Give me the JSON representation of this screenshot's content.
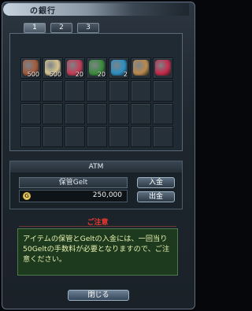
{
  "window": {
    "title": "の銀行"
  },
  "tabs": [
    {
      "label": "1"
    },
    {
      "label": "2"
    },
    {
      "label": "3"
    }
  ],
  "items": [
    {
      "icon": "meat-bundle-icon",
      "qty": "500",
      "color": "#a35a3b"
    },
    {
      "icon": "bottle-icon",
      "qty": "500",
      "color": "#d7c48f"
    },
    {
      "icon": "red-gem-icon",
      "qty": "20",
      "color": "#c23d56"
    },
    {
      "icon": "green-herb-icon",
      "qty": "20",
      "color": "#3b8b3c"
    },
    {
      "icon": "blue-crystal-icon",
      "qty": "2",
      "color": "#2d8fc2"
    },
    {
      "icon": "bread-icon",
      "qty": "",
      "color": "#b98a4d"
    },
    {
      "icon": "red-blue-orb-icon",
      "qty": "",
      "color": "#c32b4c"
    }
  ],
  "atm": {
    "heading": "ATM",
    "deposit_label": "保管Gelt",
    "coin_symbol": "G",
    "amount": "250,000",
    "deposit_button": "入金",
    "withdraw_button": "出金"
  },
  "notice": {
    "heading": "ご注意",
    "text": "アイテムの保管とGeltの入金には、一回当り50Geltの手数料が必要となりますので、ご注意ください。"
  },
  "close_button": "閉じる"
}
